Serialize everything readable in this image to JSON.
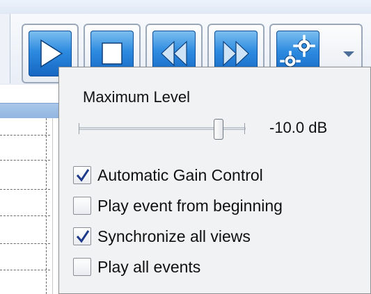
{
  "toolbar": {
    "buttons": [
      {
        "name": "play",
        "icon": "play-icon"
      },
      {
        "name": "stop",
        "icon": "stop-icon"
      },
      {
        "name": "rewind",
        "icon": "rewind-icon"
      },
      {
        "name": "fast-forward",
        "icon": "fast-forward-icon"
      },
      {
        "name": "settings",
        "icon": "gear-icon"
      }
    ],
    "accent": "#2d8be0"
  },
  "popup": {
    "max_level_label": "Maximum Level",
    "slider_value_text": "-10.0 dB",
    "slider_fraction": 0.86,
    "options": [
      {
        "label": "Automatic Gain Control",
        "checked": true
      },
      {
        "label": "Play event from beginning",
        "checked": false
      },
      {
        "label": "Synchronize all views",
        "checked": true
      },
      {
        "label": "Play all events",
        "checked": false
      }
    ]
  }
}
